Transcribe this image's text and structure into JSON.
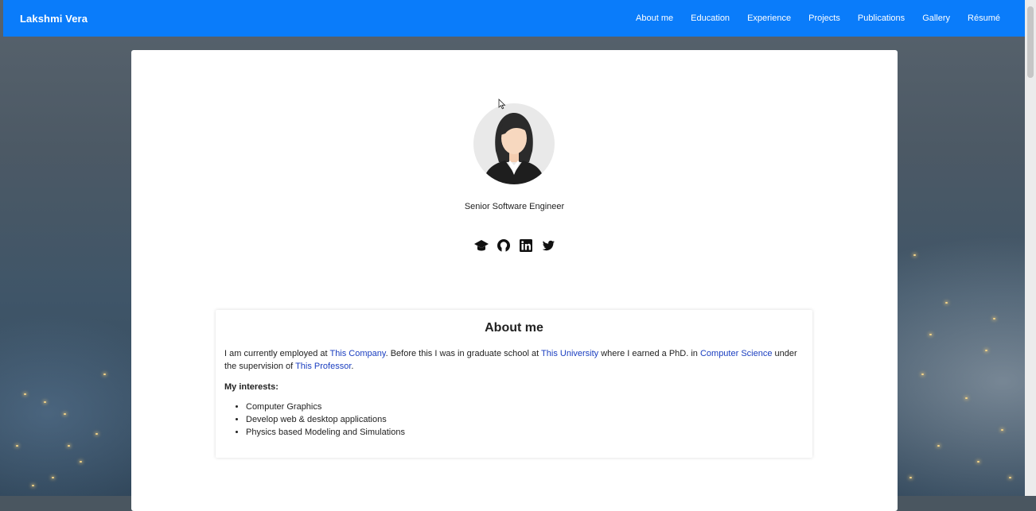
{
  "navbar": {
    "brand": "Lakshmi Vera",
    "links": [
      "About me",
      "Education",
      "Experience",
      "Projects",
      "Publications",
      "Gallery",
      "Résumé"
    ],
    "background_color": "#0a7cfa"
  },
  "profile": {
    "subtitle": "Senior Software Engineer",
    "social_icons": [
      "graduation-cap-icon",
      "github-icon",
      "linkedin-icon",
      "twitter-icon"
    ]
  },
  "about": {
    "heading": "About me",
    "intro_1": "I am currently employed at ",
    "company_link": "This Company",
    "intro_2": ". Before this I was in graduate school at ",
    "university_link": "This University",
    "intro_3": " where I earned a PhD. in ",
    "field_link": "Computer Science",
    "intro_4": " under the supervision of ",
    "professor_link": "This Professor",
    "intro_5": ".",
    "interests_label": "My interests:",
    "interests": [
      "Computer Graphics",
      "Develop web & desktop applications",
      "Physics based Modeling and Simulations"
    ],
    "link_color": "#1a3ec0"
  }
}
